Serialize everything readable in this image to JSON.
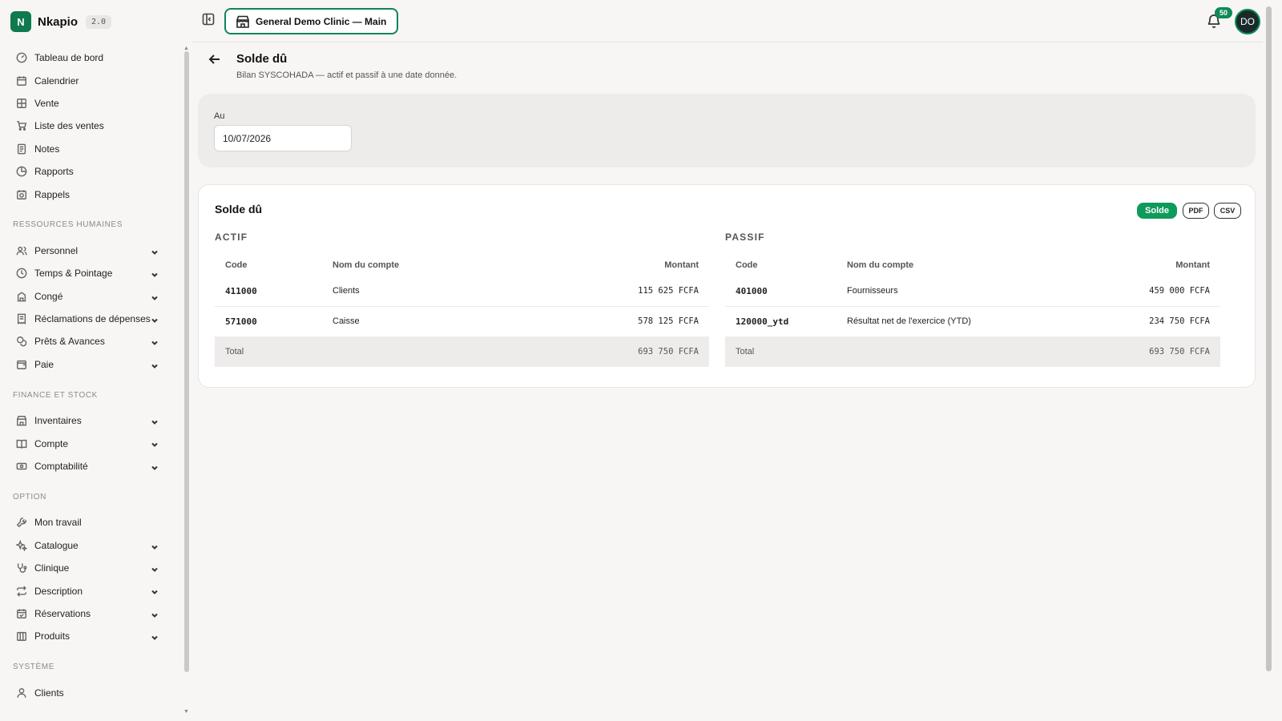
{
  "app": {
    "name": "Nkapio",
    "version": "2.0",
    "logo_letter": "N",
    "brand_color": "#0e7a4d"
  },
  "topbar": {
    "clinic": "General Demo Clinic — Main",
    "notifications": "50",
    "avatar": "DO"
  },
  "sidebar": {
    "top_items": [
      {
        "label": "Tableau de bord",
        "icon": "gauge-icon"
      },
      {
        "label": "Calendrier",
        "icon": "calendar-icon"
      },
      {
        "label": "Vente",
        "icon": "grid-icon"
      },
      {
        "label": "Liste des ventes",
        "icon": "cart-icon"
      },
      {
        "label": "Notes",
        "icon": "note-icon"
      },
      {
        "label": "Rapports",
        "icon": "pie-icon"
      },
      {
        "label": "Rappels",
        "icon": "alarm-icon"
      }
    ],
    "sections": [
      {
        "title": "RESSOURCES HUMAINES",
        "items": [
          {
            "label": "Personnel",
            "icon": "users-icon"
          },
          {
            "label": "Temps & Pointage",
            "icon": "clock-icon"
          },
          {
            "label": "Congé",
            "icon": "building-icon"
          },
          {
            "label": "Réclamations de dépenses",
            "icon": "receipt-icon"
          },
          {
            "label": "Prêts & Avances",
            "icon": "coins-icon"
          },
          {
            "label": "Paie",
            "icon": "wallet-icon"
          }
        ]
      },
      {
        "title": "FINANCE ET STOCK",
        "items": [
          {
            "label": "Inventaires",
            "icon": "store-icon"
          },
          {
            "label": "Compte",
            "icon": "book-icon"
          },
          {
            "label": "Comptabilité",
            "icon": "banknote-icon"
          }
        ]
      },
      {
        "title": "OPTION",
        "items": [
          {
            "label": "Mon travail",
            "icon": "wrench-icon"
          },
          {
            "label": "Catalogue",
            "icon": "sparkles-icon"
          },
          {
            "label": "Clinique",
            "icon": "stethoscope-icon"
          },
          {
            "label": "Description",
            "icon": "repeat-icon"
          },
          {
            "label": "Réservations",
            "icon": "calendar-check-icon"
          },
          {
            "label": "Produits",
            "icon": "package-icon"
          }
        ]
      },
      {
        "title": "SYSTÈME",
        "items": [
          {
            "label": "Clients",
            "icon": "user-icon"
          }
        ]
      }
    ]
  },
  "page": {
    "title": "Solde dû",
    "subtitle": "Bilan SYSCOHADA — actif et passif à une date donnée.",
    "filter_label": "Au",
    "filter_date": "10/07/2026"
  },
  "report": {
    "title": "Solde dû",
    "buttons": {
      "solde": "Solde",
      "pdf": "PDF",
      "csv": "CSV"
    },
    "actif": {
      "heading": "ACTIF",
      "columns": {
        "code": "Code",
        "name": "Nom du compte",
        "amount": "Montant"
      },
      "rows": [
        {
          "code": "411000",
          "name": "Clients",
          "amount": "115 625 FCFA"
        },
        {
          "code": "571000",
          "name": "Caisse",
          "amount": "578 125 FCFA"
        }
      ],
      "total_label": "Total",
      "total": "693 750 FCFA"
    },
    "passif": {
      "heading": "PASSIF",
      "columns": {
        "code": "Code",
        "name": "Nom du compte",
        "amount": "Montant"
      },
      "rows": [
        {
          "code": "401000",
          "name": "Fournisseurs",
          "amount": "459 000 FCFA"
        },
        {
          "code": "120000_ytd",
          "name": "Résultat net de l'exercice (YTD)",
          "amount": "234 750 FCFA"
        }
      ],
      "total_label": "Total",
      "total": "693 750 FCFA"
    }
  }
}
